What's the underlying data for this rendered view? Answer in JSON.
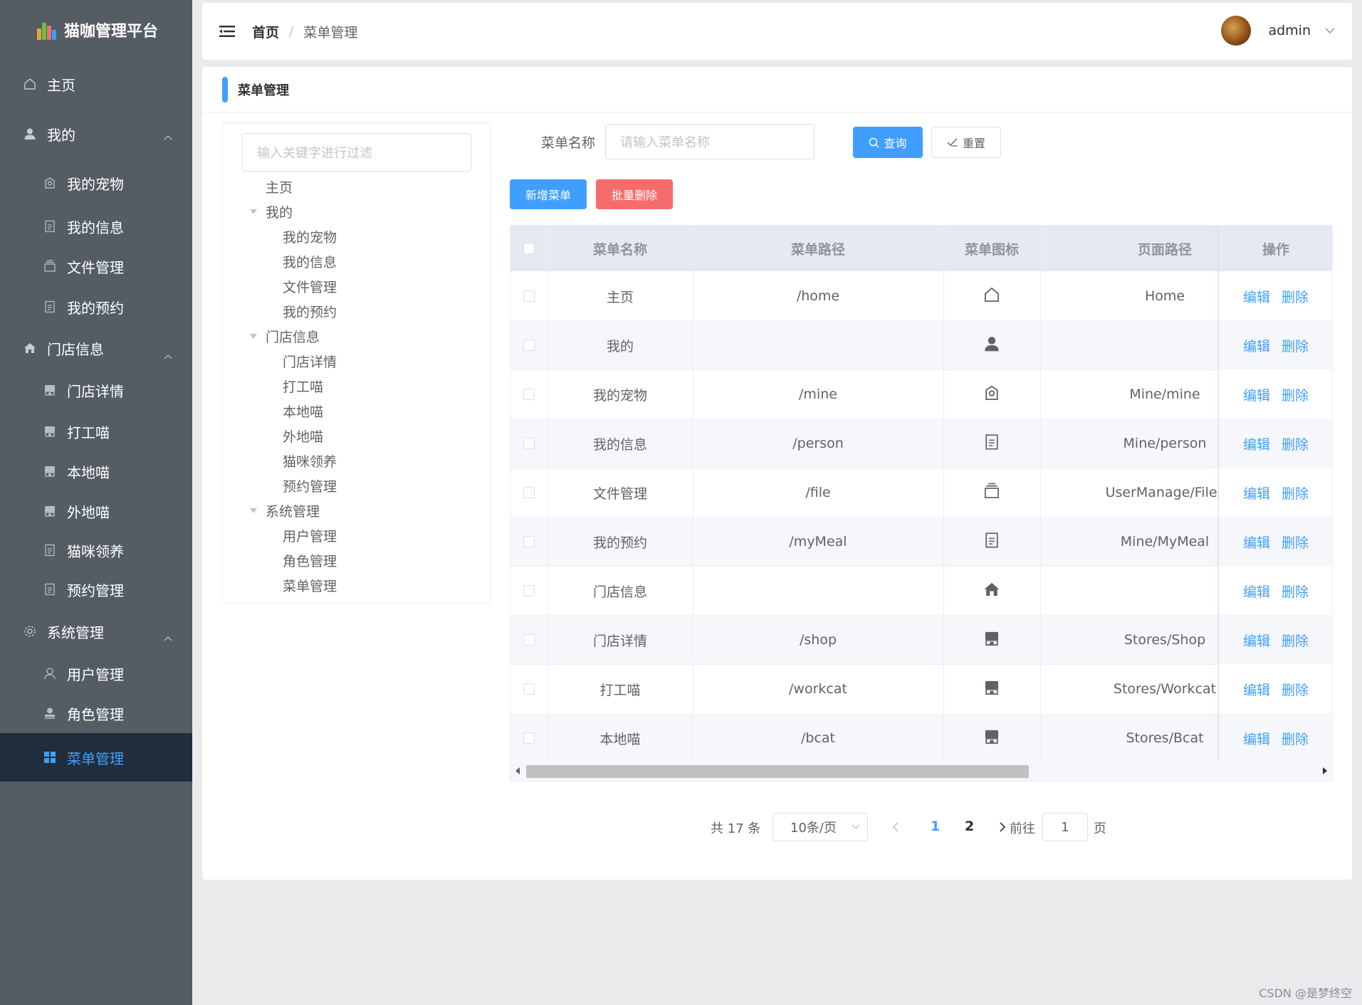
{
  "app": {
    "title": "猫咖管理平台"
  },
  "sidebar": {
    "items": [
      {
        "label": "主页",
        "icon": "home-icon"
      },
      {
        "label": "我的",
        "icon": "user-icon",
        "expanded": true
      },
      {
        "label": "我的宠物",
        "icon": "pet-icon"
      },
      {
        "label": "我的信息",
        "icon": "document-icon"
      },
      {
        "label": "文件管理",
        "icon": "files-icon"
      },
      {
        "label": "我的预约",
        "icon": "document-icon"
      },
      {
        "label": "门店信息",
        "icon": "house-icon",
        "expanded": true
      },
      {
        "label": "门店详情",
        "icon": "shop-icon"
      },
      {
        "label": "打工喵",
        "icon": "shop-icon"
      },
      {
        "label": "本地喵",
        "icon": "shop-icon"
      },
      {
        "label": "外地喵",
        "icon": "shop-icon"
      },
      {
        "label": "猫咪领养",
        "icon": "document-icon"
      },
      {
        "label": "预约管理",
        "icon": "document-icon"
      },
      {
        "label": "系统管理",
        "icon": "gear-icon",
        "expanded": true
      },
      {
        "label": "用户管理",
        "icon": "user-outline-icon"
      },
      {
        "label": "角色管理",
        "icon": "role-icon"
      },
      {
        "label": "菜单管理",
        "icon": "grid-icon",
        "active": true
      }
    ],
    "colors": {
      "bg": "#545c64",
      "active_bg": "#1f2d3d",
      "active_text": "#409eff"
    }
  },
  "header": {
    "breadcrumb": {
      "home": "首页",
      "current": "菜单管理"
    },
    "user": "admin"
  },
  "card": {
    "title": "菜单管理"
  },
  "tree": {
    "filter_placeholder": "输入关键字进行过滤",
    "nodes": [
      "主页",
      "我的",
      "我的宠物",
      "我的信息",
      "文件管理",
      "我的预约",
      "门店信息",
      "门店详情",
      "打工喵",
      "本地喵",
      "外地喵",
      "猫咪领养",
      "预约管理",
      "系统管理",
      "用户管理",
      "角色管理",
      "菜单管理"
    ]
  },
  "search": {
    "label": "菜单名称",
    "placeholder": "请输入菜单名称",
    "query_btn": "查询",
    "reset_btn": "重置"
  },
  "actions": {
    "add": "新增菜单",
    "batch_delete": "批量删除"
  },
  "table": {
    "headers": [
      "菜单名称",
      "菜单路径",
      "菜单图标",
      "页面路径",
      "操作"
    ],
    "rows": [
      {
        "name": "主页",
        "path": "/home",
        "icon": "home-icon",
        "page": "Home"
      },
      {
        "name": "我的",
        "path": "",
        "icon": "user-icon",
        "page": ""
      },
      {
        "name": "我的宠物",
        "path": "/mine",
        "icon": "pet-icon",
        "page": "Mine/mine"
      },
      {
        "name": "我的信息",
        "path": "/person",
        "icon": "document-icon",
        "page": "Mine/person"
      },
      {
        "name": "文件管理",
        "path": "/file",
        "icon": "files-icon",
        "page": "UserManage/Files"
      },
      {
        "name": "我的预约",
        "path": "/myMeal",
        "icon": "document-icon",
        "page": "Mine/MyMeal"
      },
      {
        "name": "门店信息",
        "path": "",
        "icon": "house-icon",
        "page": ""
      },
      {
        "name": "门店详情",
        "path": "/shop",
        "icon": "shop-icon",
        "page": "Stores/Shop"
      },
      {
        "name": "打工喵",
        "path": "/workcat",
        "icon": "shop-icon",
        "page": "Stores/Workcat"
      },
      {
        "name": "本地喵",
        "path": "/bcat",
        "icon": "shop-icon",
        "page": "Stores/Bcat"
      }
    ],
    "edit_label": "编辑",
    "delete_label": "删除"
  },
  "pagination": {
    "total_text": "共 17 条",
    "page_size": "10条/页",
    "pages": [
      "1",
      "2"
    ],
    "current": "1",
    "goto_label": "前往",
    "goto_value": "1",
    "page_suffix": "页"
  },
  "watermark": "CSDN @是梦终空"
}
